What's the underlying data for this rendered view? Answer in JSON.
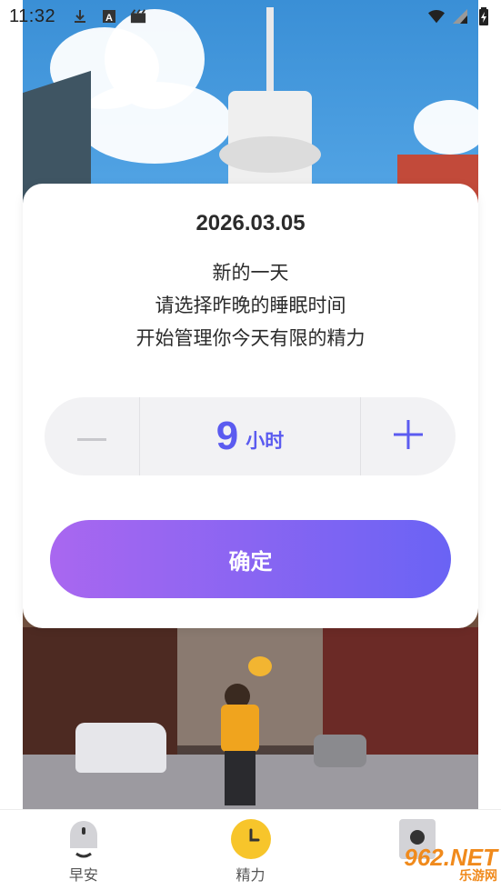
{
  "statusbar": {
    "time": "11:32",
    "icons": [
      "download-icon",
      "a-badge-icon",
      "media-icon",
      "wifi-icon",
      "signal-icon",
      "battery-charging-icon"
    ]
  },
  "dialog": {
    "date": "2026.03.05",
    "lines": [
      "新的一天",
      "请选择昨晚的睡眠时间",
      "开始管理你今天有限的精力"
    ],
    "stepper": {
      "value": "9",
      "unit": "小时",
      "minus_icon": "minus-icon",
      "plus_icon": "plus-icon"
    },
    "confirm_label": "确定"
  },
  "bottom_nav": {
    "items": [
      {
        "label": "早安",
        "icon": "bell-icon",
        "active": false
      },
      {
        "label": "精力",
        "icon": "clock-icon",
        "active": true
      },
      {
        "label": "",
        "icon": "record-icon",
        "active": false
      }
    ]
  },
  "watermark": {
    "main": "962.NET",
    "sub": "乐游网"
  },
  "colors": {
    "accent": "#5b5bf0",
    "button_gradient_start": "#a967f0",
    "button_gradient_end": "#6a63f4",
    "clock_icon_bg": "#f7c52b",
    "watermark": "#f08a1c"
  }
}
